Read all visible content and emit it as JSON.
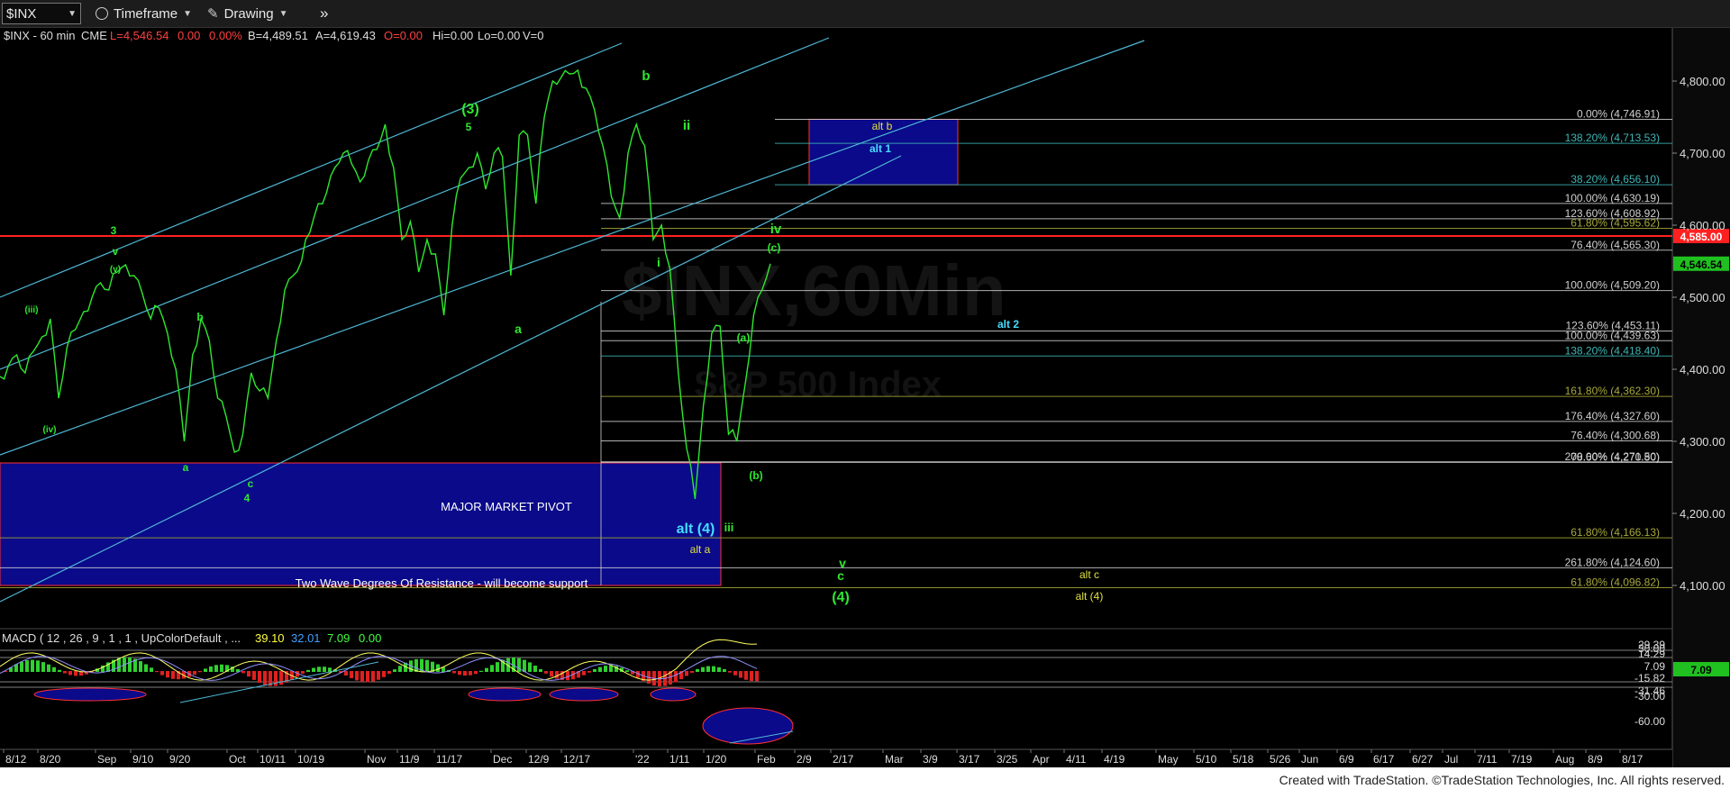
{
  "toolbar": {
    "symbol": "$INX",
    "timeframe_label": "Timeframe",
    "drawing_label": "Drawing",
    "more_glyph": "»"
  },
  "info_line": {
    "symbol_tf": "$INX - 60 min",
    "exchange": "CME",
    "last": "L=4,546.54",
    "change": "0.00",
    "pct": "0.00%",
    "bid": "B=4,489.51",
    "ask": "A=4,619.43",
    "open": "O=0.00",
    "hi": "Hi=0.00",
    "lo": "Lo=0.00",
    "vol": "V=0"
  },
  "watermark": {
    "main": "$INX,60Min",
    "sub": "S&P 500 Index"
  },
  "colors": {
    "price": "#2ee82e",
    "fib_white": "#d0d0d0",
    "fib_teal": "#3fb5b5",
    "fib_olive": "#a8a83a",
    "channel": "#4fb8d6",
    "red_line": "#ff2020",
    "pivot_box": "#0a0a8a",
    "yellow_label": "#e0e040",
    "cyan_label": "#44ddff"
  },
  "chart_data": {
    "type": "line",
    "title": "$INX,60Min",
    "subtitle": "S&P 500 Index",
    "ylim": [
      4060,
      4870
    ],
    "y_ticks": [
      4100,
      4200,
      4300,
      4400,
      4500,
      4600,
      4700,
      4800
    ],
    "y_tick_labels": [
      "4,100.00",
      "4,200.00",
      "4,300.00",
      "4,400.00",
      "4,500.00",
      "4,600.00",
      "4,700.00",
      "4,800.00"
    ],
    "x_tick_labels": [
      "8/12",
      "8/20",
      "Sep",
      "9/10",
      "9/20",
      "Oct",
      "10/11",
      "10/19",
      "Nov",
      "11/9",
      "11/17",
      "Dec",
      "12/9",
      "12/17",
      "'22",
      "1/11",
      "1/20",
      "Feb",
      "2/9",
      "2/17",
      "Mar",
      "3/9",
      "3/17",
      "3/25",
      "Apr",
      "4/11",
      "4/19",
      "May",
      "5/10",
      "5/18",
      "5/26",
      "Jun",
      "6/9",
      "6/17",
      "6/27",
      "Jul",
      "7/11",
      "7/19",
      "Aug",
      "8/9",
      "8/17"
    ],
    "last_price": 4546.54,
    "last_price_label": "4,546.54",
    "red_line_value": 4585,
    "red_line_label": "4,585.00",
    "series": [
      {
        "values": [
          [
            0,
            4390
          ],
          [
            1,
            4405
          ],
          [
            2,
            4420
          ],
          [
            3,
            4395
          ],
          [
            4,
            4425
          ],
          [
            5,
            4445
          ],
          [
            6,
            4470
          ],
          [
            7,
            4360
          ],
          [
            8,
            4430
          ],
          [
            9,
            4455
          ],
          [
            10,
            4480
          ],
          [
            11,
            4500
          ],
          [
            12,
            4520
          ],
          [
            13,
            4510
          ],
          [
            14,
            4535
          ],
          [
            15,
            4545
          ],
          [
            16,
            4530
          ],
          [
            17,
            4505
          ],
          [
            18,
            4470
          ],
          [
            19,
            4485
          ],
          [
            20,
            4450
          ],
          [
            21,
            4400
          ],
          [
            22,
            4300
          ],
          [
            23,
            4420
          ],
          [
            24,
            4470
          ],
          [
            25,
            4440
          ],
          [
            26,
            4360
          ],
          [
            27,
            4335
          ],
          [
            28,
            4285
          ],
          [
            29,
            4310
          ],
          [
            30,
            4395
          ],
          [
            31,
            4370
          ],
          [
            32,
            4360
          ],
          [
            33,
            4440
          ],
          [
            34,
            4510
          ],
          [
            35,
            4530
          ],
          [
            36,
            4550
          ],
          [
            37,
            4590
          ],
          [
            38,
            4630
          ],
          [
            39,
            4645
          ],
          [
            40,
            4680
          ],
          [
            41,
            4700
          ],
          [
            42,
            4685
          ],
          [
            43,
            4660
          ],
          [
            44,
            4690
          ],
          [
            45,
            4705
          ],
          [
            46,
            4740
          ],
          [
            47,
            4680
          ],
          [
            48,
            4580
          ],
          [
            49,
            4605
          ],
          [
            50,
            4535
          ],
          [
            51,
            4580
          ],
          [
            52,
            4560
          ],
          [
            53,
            4475
          ],
          [
            54,
            4600
          ],
          [
            55,
            4665
          ],
          [
            56,
            4680
          ],
          [
            57,
            4700
          ],
          [
            58,
            4650
          ],
          [
            59,
            4700
          ],
          [
            60,
            4695
          ],
          [
            61,
            4530
          ],
          [
            62,
            4725
          ],
          [
            63,
            4725
          ],
          [
            64,
            4630
          ],
          [
            65,
            4750
          ],
          [
            66,
            4800
          ],
          [
            67,
            4805
          ],
          [
            68,
            4810
          ],
          [
            69,
            4815
          ],
          [
            70,
            4790
          ],
          [
            71,
            4760
          ],
          [
            72,
            4710
          ],
          [
            73,
            4640
          ],
          [
            74,
            4610
          ],
          [
            75,
            4700
          ],
          [
            76,
            4740
          ],
          [
            77,
            4710
          ],
          [
            78,
            4580
          ],
          [
            79,
            4600
          ],
          [
            80,
            4540
          ],
          [
            81,
            4395
          ],
          [
            82,
            4290
          ],
          [
            83,
            4220
          ],
          [
            84,
            4350
          ],
          [
            85,
            4450
          ],
          [
            86,
            4460
          ],
          [
            87,
            4310
          ],
          [
            88,
            4300
          ],
          [
            89,
            4380
          ],
          [
            90,
            4475
          ],
          [
            91,
            4510
          ],
          [
            92,
            4546.54
          ]
        ]
      }
    ],
    "fib_levels": [
      {
        "label": "0.00% (4,746.91)",
        "value": 4746.91,
        "color": "fib_white"
      },
      {
        "label": "138.20% (4,713.53)",
        "value": 4713.53,
        "color": "fib_teal"
      },
      {
        "label": "38.20% (4,656.10)",
        "value": 4656.1,
        "color": "fib_teal"
      },
      {
        "label": "100.00% (4,630.19)",
        "value": 4630.19,
        "color": "fib_white"
      },
      {
        "label": "123.60% (4,608.92)",
        "value": 4608.92,
        "color": "fib_white"
      },
      {
        "label": "61.80% (4,595.62)",
        "value": 4595.62,
        "color": "fib_olive"
      },
      {
        "label": "76.40% (4,565.30)",
        "value": 4565.3,
        "color": "fib_white"
      },
      {
        "label": "100.00% (4,509.20)",
        "value": 4509.2,
        "color": "fib_white"
      },
      {
        "label": "123.60% (4,453.11)",
        "value": 4453.11,
        "color": "fib_white"
      },
      {
        "label": "100.00% (4,439.63)",
        "value": 4439.63,
        "color": "fib_white"
      },
      {
        "label": "138.20% (4,418.40)",
        "value": 4418.4,
        "color": "fib_teal"
      },
      {
        "label": "161.80% (4,362.30)",
        "value": 4362.3,
        "color": "fib_olive"
      },
      {
        "label": "176.40% (4,327.60)",
        "value": 4327.6,
        "color": "fib_white"
      },
      {
        "label": "76.40% (4,300.68)",
        "value": 4300.68,
        "color": "fib_white"
      },
      {
        "label": "200.00% (4,271.50)",
        "value": 4271.5,
        "color": "fib_white"
      },
      {
        "label": "78.60% (4,270.80)",
        "value": 4270.8,
        "color": "fib_white"
      },
      {
        "label": "61.80% (4,166.13)",
        "value": 4166.13,
        "color": "fib_olive"
      },
      {
        "label": "261.80% (4,124.60)",
        "value": 4124.6,
        "color": "fib_white"
      },
      {
        "label": "61.80% (4,096.82)",
        "value": 4096.82,
        "color": "fib_olive"
      }
    ],
    "annotations": {
      "green": [
        "(iii)",
        "(iv)",
        "3",
        "v",
        "(v)",
        "b",
        "a",
        "c",
        "4",
        "(3)",
        "5",
        "a",
        "b",
        "ii",
        "i",
        "iv",
        "(c)",
        "(a)",
        "(b)",
        "iii",
        "v",
        "c",
        "(4)"
      ],
      "yellow": [
        "alt b",
        "alt a",
        "alt c",
        "alt (4)"
      ],
      "cyan": [
        "alt 1",
        "alt 2",
        "alt (4)"
      ],
      "white": [
        "MAJOR MARKET PIVOT",
        "Two Wave Degrees Of Resistance - will become support"
      ]
    },
    "macd": {
      "title": "MACD ( 12 , 26 , 9 , 1 , 1 , UpColorDefault , ...",
      "values_labels": [
        "39.10",
        "32.01",
        "7.09",
        "0.00"
      ],
      "scale_labels": [
        "29.39",
        "30.00",
        "14.29",
        "7.09",
        "-15.82",
        "-31.46",
        "-30.00",
        "-60.00"
      ]
    }
  },
  "footer": "Created with TradeStation. ©TradeStation Technologies, Inc. All rights reserved."
}
